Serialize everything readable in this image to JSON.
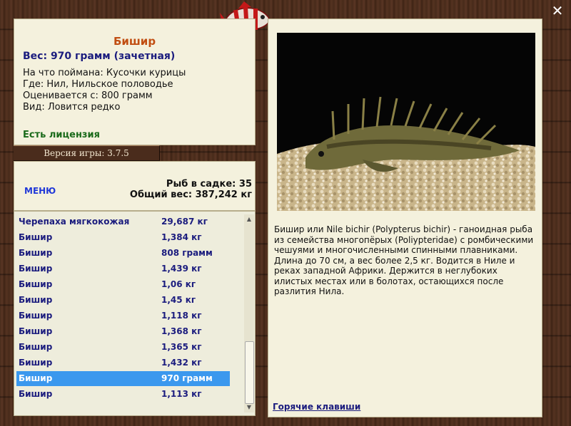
{
  "info": {
    "fish_name": "Бишир",
    "weight_line": "Вес: 970 грамм (зачетная)",
    "caught_on": "На что поймана: Кусочки курицы",
    "location": "Где: Нил, Нильское половодье",
    "valued_from": "Оценивается с: 800 грамм",
    "view": "Вид: Ловится редко",
    "license": "Есть лицензия"
  },
  "version": "Версия игры: 3.7.5",
  "status": {
    "menu_label": "МЕНЮ",
    "fish_count": "Рыб в садке: 35",
    "total_weight": "Общий вес: 387,242 кг"
  },
  "catch_list": [
    {
      "name": "Черепаха мягкокожая",
      "weight": "29,687 кг",
      "selected": false
    },
    {
      "name": "Бишир",
      "weight": "1,384 кг",
      "selected": false
    },
    {
      "name": "Бишир",
      "weight": "808 грамм",
      "selected": false
    },
    {
      "name": "Бишир",
      "weight": "1,439 кг",
      "selected": false
    },
    {
      "name": "Бишир",
      "weight": "1,06 кг",
      "selected": false
    },
    {
      "name": "Бишир",
      "weight": "1,45 кг",
      "selected": false
    },
    {
      "name": "Бишир",
      "weight": "1,118 кг",
      "selected": false
    },
    {
      "name": "Бишир",
      "weight": "1,368 кг",
      "selected": false
    },
    {
      "name": "Бишир",
      "weight": "1,365 кг",
      "selected": false
    },
    {
      "name": "Бишир",
      "weight": "1,432 кг",
      "selected": false
    },
    {
      "name": "Бишир",
      "weight": "970 грамм",
      "selected": true
    },
    {
      "name": "Бишир",
      "weight": "1,113 кг",
      "selected": false
    }
  ],
  "description": "Бишир или Nile bichir (Polypterus bichir) - ганоидная рыба из семейства многопёрых (Poliypteridae) с ромбическими чешуями и многочисленными спинными плавниками. Длина до 70 см, а вес более 2,5 кг. Водится в Ниле и реках западной Африки. Держится в неглубоких илистых местах или в болотах, остающихся после разлития Нила.",
  "hotkeys_label": "Горячие клавиши",
  "icons": {
    "close": "close-icon",
    "logo": "fish-logo-icon",
    "scroll_up": "scroll-up-arrow-icon",
    "scroll_down": "scroll-down-arrow-icon"
  },
  "colors": {
    "fish_name": "#c14e12",
    "weight": "#1b1c7e",
    "license": "#1a6a1a",
    "selection": "#3b98ee",
    "panel": "#f4f1dd"
  }
}
